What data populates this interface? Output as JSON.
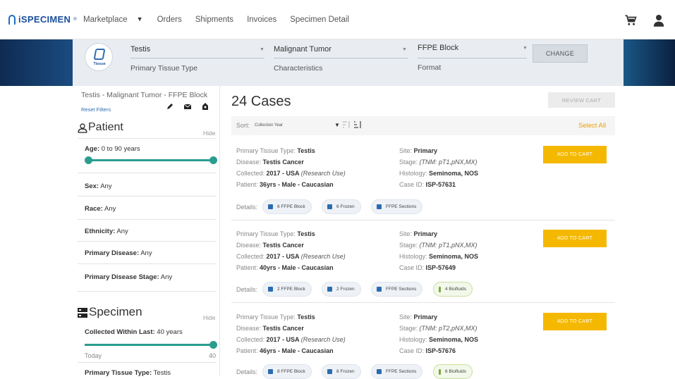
{
  "nav": {
    "logo": "iSPECIMEN",
    "logo_tm": "®",
    "links": [
      "Marketplace",
      "Orders",
      "Shipments",
      "Invoices",
      "Specimen Detail"
    ],
    "cart_icon": "cart-icon",
    "user_icon": "user-icon"
  },
  "banner": {
    "badge_caption": "Tissue",
    "tissue_value": "Testis",
    "tissue_label": "Primary Tissue Type",
    "char_value": "Malignant Tumor",
    "char_label": "Characteristics",
    "format_value": "FFPE Block",
    "format_label": "Format",
    "change_label": "CHANGE"
  },
  "sidebar": {
    "crumb": "Testis - Malignant Tumor - FFPE Block",
    "reset": "Reset Filters",
    "patient": {
      "title": "Patient",
      "hide": "Hide",
      "age_label": "Age:",
      "age_value": " 0 to 90 years",
      "sex_label": "Sex:",
      "sex_value": " Any",
      "race_label": "Race:",
      "race_value": " Any",
      "eth_label": "Ethnicity:",
      "eth_value": " Any",
      "pd_label": "Primary Disease:",
      "pd_value": " Any",
      "pds_label": "Primary Disease Stage:",
      "pds_value": " Any"
    },
    "specimen": {
      "title": "Specimen",
      "hide": "Hide",
      "cwl_label": "Collected Within Last:",
      "cwl_value": " 40 years",
      "today": "Today",
      "max": "40",
      "ptt_label": "Primary Tissue Type:",
      "ptt_value": " Testis"
    }
  },
  "main": {
    "title": "24 Cases",
    "review_cart": "REVIEW CART",
    "sort_label": "Sort:",
    "sort_value": "Collection Year",
    "select_all": "Select All",
    "labels": {
      "ptt": "Primary Tissue Type: ",
      "disease": "Disease: ",
      "collected": "Collected: ",
      "patient": "Patient: ",
      "site": "Site: ",
      "stage": "Stage: ",
      "histology": "Histology: ",
      "case_id": "Case ID: ",
      "details": "Details:",
      "add_to_cart": "ADD TO CART"
    },
    "cases": [
      {
        "ptt": "Testis",
        "disease": "Testis Cancer",
        "collected": "2017 - USA ",
        "use": "(Research Use)",
        "patient": "36yrs - Male - Caucasian",
        "site": "Primary",
        "stage": "(TNM: pT1,pNX,MX)",
        "histology": "Seminoma, NOS",
        "case_id": "ISP-57631",
        "pills": [
          "6 FFPE Block",
          "6 Frozen",
          "FFPE Sections"
        ]
      },
      {
        "ptt": "Testis",
        "disease": "Testis Cancer",
        "collected": "2017 - USA ",
        "use": "(Research Use)",
        "patient": "40yrs - Male - Caucasian",
        "site": "Primary",
        "stage": "(TNM: pT1,pNX,MX)",
        "histology": "Seminoma, NOS",
        "case_id": "ISP-57649",
        "pills": [
          "2 FFPE Block",
          "2 Frozen",
          "FFPE Sections",
          "4 Biofluids"
        ]
      },
      {
        "ptt": "Testis",
        "disease": "Testis Cancer",
        "collected": "2017 - USA ",
        "use": "(Research Use)",
        "patient": "46yrs - Male - Caucasian",
        "site": "Primary",
        "stage": "(TNM: pT2,pNX,MX)",
        "histology": "Seminoma, NOS",
        "case_id": "ISP-57676",
        "pills": [
          "8 FFPE Block",
          "8 Frozen",
          "FFPE Sections",
          "6 Biofluids"
        ]
      }
    ]
  },
  "colors": {
    "accent": "#f5b800",
    "slider": "#2a9d8f",
    "link": "#2b6cb0",
    "select_all": "#e8a000"
  }
}
